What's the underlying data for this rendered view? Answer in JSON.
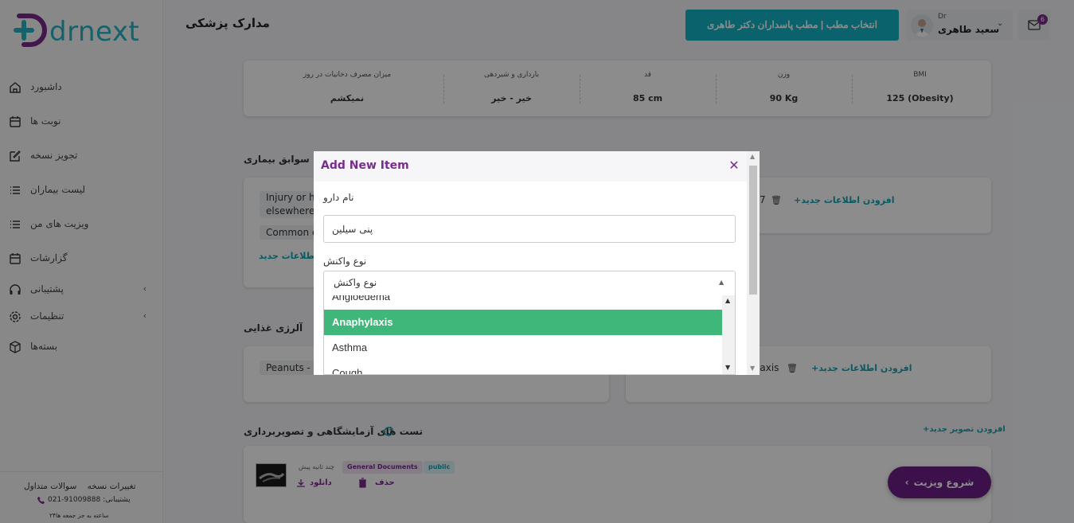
{
  "brand": {
    "logo_text": "drnext",
    "primary_color": "#13b3c7",
    "accent_color": "#7b2a8f",
    "highlight_color": "#3fb77a"
  },
  "header": {
    "page_title": "مدارک پزشکی",
    "clinic_button": "انتخاب مطب | مطب پاسداران دکتر طاهری",
    "user": {
      "prefix": "Dr",
      "name": "سعید طاهری"
    },
    "mail_badge": "6"
  },
  "sidebar": {
    "items": [
      {
        "label": "داشبورد",
        "icon": "home-icon"
      },
      {
        "label": "نوبت ها",
        "icon": "calendar-icon"
      },
      {
        "label": "تجویز نسخه",
        "icon": "edit-icon"
      },
      {
        "label": "لیست بیماران",
        "icon": "list-icon"
      },
      {
        "label": "ویزیت های من",
        "icon": "list-icon"
      },
      {
        "label": "گزارشات",
        "icon": "calendar-icon"
      },
      {
        "label": "پشتیبانی",
        "icon": "headset-icon",
        "expandable": true
      },
      {
        "label": "تنظیمات",
        "icon": "gear-icon",
        "expandable": true
      },
      {
        "label": "بسته‌ها",
        "icon": "box-icon"
      }
    ],
    "footer": {
      "faq": "سوالات متداول",
      "changes": "تغییرات نسخه",
      "support_phone": "021-91009888 :پشتیبانی",
      "hours": "۲۴ساعته به جز جمعه ها"
    }
  },
  "vitals": [
    {
      "label": "BMI",
      "value": "125 (Obesity)"
    },
    {
      "label": "وزن",
      "value": "90 Kg"
    },
    {
      "label": "قد",
      "value": "85 cm"
    },
    {
      "label": "بارداری و شیردهی",
      "value": "خیر - خیر"
    },
    {
      "label": "میزان مصرف دخانیات در روز",
      "value": "نمیکشم"
    }
  ],
  "medical_history": {
    "title": "سوابق بیماری",
    "chips": [
      "Injury or ho",
      "elsewhere",
      "Common c"
    ],
    "add_link": "+افزودن اطلاعات جدید",
    "add_link_partial": "ه اطلاعات جدید",
    "right_chip": "7"
  },
  "food_allergy": {
    "title": "آلرژی غذایی",
    "chips": [
      "Peanuts - S"
    ],
    "right_chip": "ylaxis",
    "add_link": "+افزودن اطلاعات جدید"
  },
  "tests": {
    "title": "تست های آزمایشگاهی و تصویربرداری",
    "add_image": "+افزودن تصویر جدید",
    "item": {
      "time": "چند ثانیه پیش",
      "category": "General Documents",
      "visibility": "public",
      "download": "دانلود",
      "delete": "حذف"
    }
  },
  "visit_button": "شروع ویزیت",
  "modal": {
    "title": "Add New Item",
    "drug_label": "نام دارو",
    "drug_value": "پنی سیلین",
    "reaction_label": "نوع واکنش",
    "reaction_selected": "نوع واکنش",
    "options": [
      "Angioedema",
      "Anaphylaxis",
      "Asthma",
      "Cough"
    ],
    "active_option": "Anaphylaxis"
  }
}
